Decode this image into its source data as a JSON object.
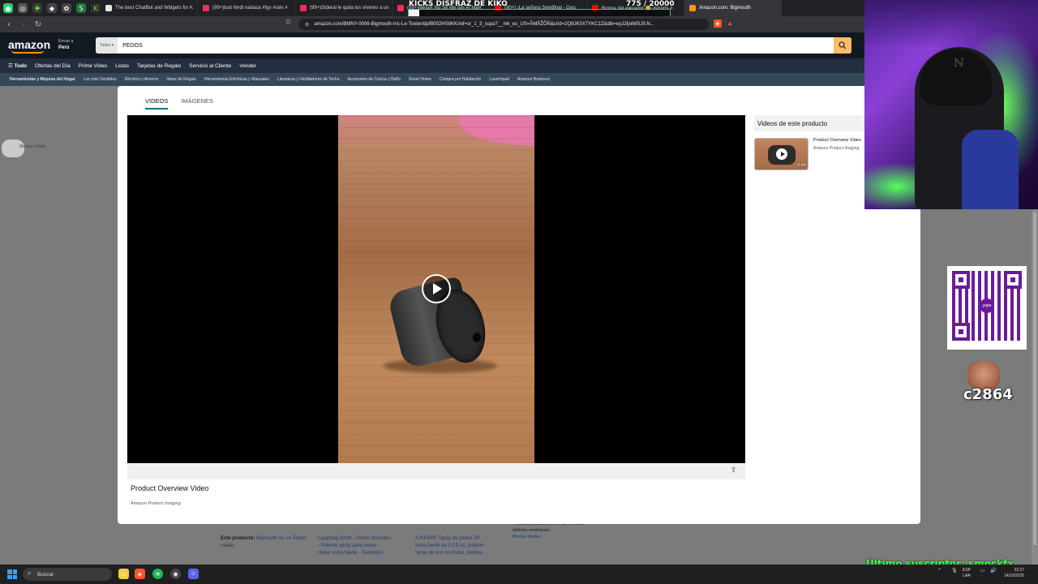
{
  "browser": {
    "tabs": [
      {
        "title": "The best ChatBot and Widgets for K",
        "color": "#e8e8e8"
      },
      {
        "title": "(99+)buti hindi nabasa #fyp #rain #",
        "color": "#ff2d55"
      },
      {
        "title": "(99+)Sideral le quita los víveres a un",
        "color": "#ff2d55"
      },
      {
        "title": "(99+)MeIaR No Se MeTaN Al MaR",
        "color": "#ff2d55"
      },
      {
        "title": "(90+) ¡La señora Semifinal - Goo",
        "color": "#ff0000"
      },
      {
        "title": "Broma del elevador 😂 #shorts #",
        "color": "#ff0000"
      },
      {
        "title": "Amazon.com: Bigmouth",
        "color": "#ff9900"
      }
    ],
    "url": "amazon.com/BMNY-0006-Bigmouth-Inc-Le-Tooter/dp/B002HSIIKK/ref=sr_1_3_sspa?__mk_es_US=ÅMÅŽÕÑ&crid=2Q9JK0X7YKC1Z&dib=eyJ2IjoiMSJ9.N..."
  },
  "stream": {
    "overlay_title": "KICKS DISFRAZ DE KIKO",
    "goal_count": "775 / 20000",
    "goal_fraction": 0.039,
    "sub_count": "c2864",
    "last_sub": "Último suscriptor: smockfx",
    "qr_label": "yape"
  },
  "amazon": {
    "logo": "amazon",
    "deliver_line1": "Enviar a",
    "deliver_line2": "Perú",
    "search_category": "Todos",
    "search_query": "PEDOS",
    "nav": [
      "Todo",
      "Ofertas del Día",
      "Prime Video",
      "Listas",
      "Tarjetas de Regalo",
      "Servicio al Cliente",
      "Vender"
    ],
    "subnav": [
      "Herramientas y Mejoras del Hogar",
      "Los más Vendidos",
      "Eléctrico y Ahorros",
      "Ideas de Regalo",
      "Herramientas Eléctricas y Manuales",
      "Lámparas y Ventiladores de Techo",
      "Accesorios de Cocina y Baño",
      "Smart Home",
      "Compra por Habitación",
      "Launchpad",
      "Amazon Business"
    ]
  },
  "modal": {
    "tabs": [
      "VIDEOS",
      "IMÁGENES"
    ],
    "video_title": "Product Overview Video",
    "video_by": "Amazon Product Imaging",
    "side_head": "Videos de este producto",
    "side_item_title": "Product Overview Video",
    "side_item_by": "Amazon Product Imaging",
    "side_item_duration": "0:44"
  },
  "background_products": {
    "this_product_label": "Este producto:",
    "this_product_name": "Bigmouth Inc Le Tooter",
    "this_product_extra": "usado",
    "p2_line1": "Laughing Smith - Pedos húmedos",
    "p2_line2": "- Potente spray para olores -",
    "p2_line3": "Hedor extra fuerte - Divertidos",
    "p3_line1": "A AIFAMY Spray de pedos 3P",
    "p3_line2": "extra fuerte de 1.0 fl oz, potente",
    "p3_line3": "spray de olor no tóxico, bomba ...",
    "p4_line1": "Estos productos los envían y venden",
    "p4_line2": "distintos vendedores.",
    "p4_line3": "Mostrar detalles"
  },
  "ghost_text": "Mostrar detalle",
  "taskbar": {
    "search_placeholder": "Buscar",
    "lang_line1": "ESP",
    "lang_line2": "LAA",
    "time": "22:27",
    "date": "14/10/2025"
  }
}
